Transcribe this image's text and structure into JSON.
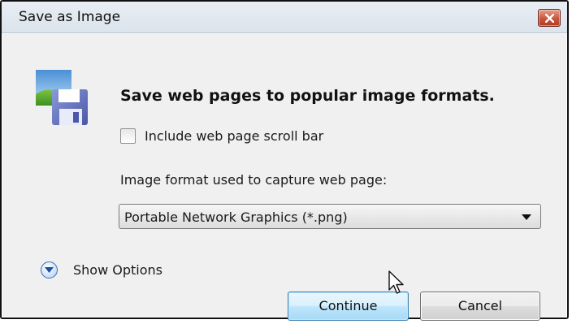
{
  "dialog": {
    "title": "Save as Image",
    "close_icon": "close-icon",
    "app_icon": "save-image-floppy-icon",
    "heading": "Save web pages to popular image formats.",
    "include_scrollbar": {
      "label": "Include web page scroll bar",
      "checked": false
    },
    "format": {
      "label": "Image format used to capture web page:",
      "selected": "Portable Network Graphics (*.png)"
    },
    "show_options": {
      "label": "Show Options",
      "icon": "chevron-down-circle-icon"
    },
    "buttons": {
      "continue": "Continue",
      "cancel": "Cancel"
    }
  },
  "colors": {
    "close_button": "#c8553b",
    "primary_button_border": "#3c7fb1",
    "accent_blue": "#3f6fb3"
  }
}
